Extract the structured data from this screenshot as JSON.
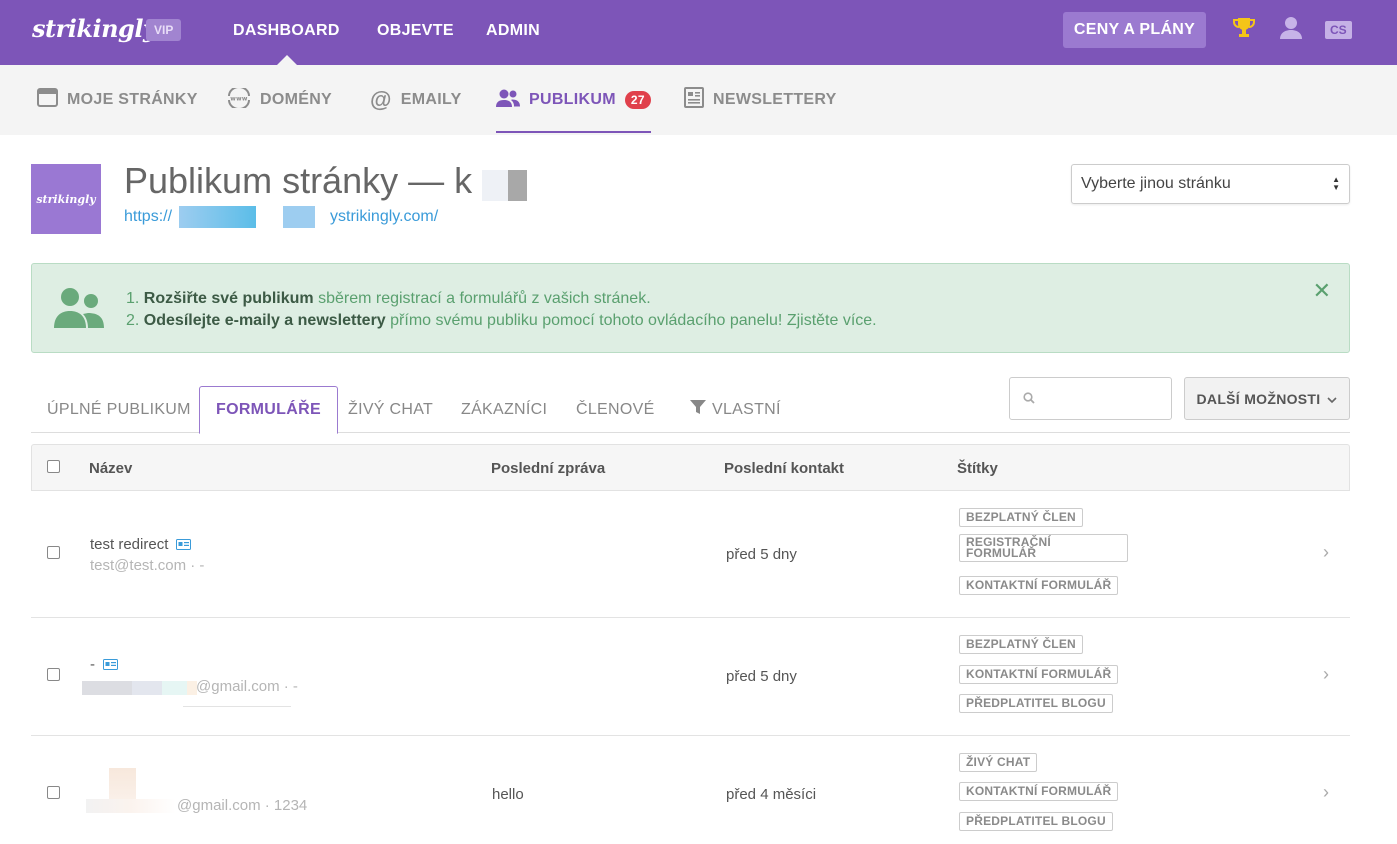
{
  "topbar": {
    "logo": "strikingly",
    "vip_badge": "VIP",
    "nav": [
      "DASHBOARD",
      "OBJEVTE",
      "ADMIN"
    ],
    "plans_button": "CENY A PLÁNY",
    "language": "CS",
    "accent_color": "#7d55b8"
  },
  "subnav": {
    "items": [
      {
        "label": "MOJE STRÁNKY",
        "icon": "browser-window-icon"
      },
      {
        "label": "DOMÉNY",
        "icon": "www-globe-icon"
      },
      {
        "label": "EMAILY",
        "icon": "at-sign-icon"
      },
      {
        "label": "PUBLIKUM",
        "icon": "users-icon",
        "badge": "27",
        "active": true
      },
      {
        "label": "NEWSLETTERY",
        "icon": "newsletter-icon"
      }
    ]
  },
  "page": {
    "thumb_text": "strikingly",
    "title": "Publikum stránky — k",
    "url_prefix": "https://",
    "url_suffix": "ystrikingly.com/",
    "site_select": "Vyberte jinou stránku"
  },
  "info": {
    "line1_num": "1.",
    "line1_bold": "Rozšiřte své publikum",
    "line1_rest": "sběrem registrací a formulářů z vašich stránek.",
    "line2_num": "2.",
    "line2_bold": "Odesílejte e-maily a newslettery",
    "line2_rest": "přímo svému publiku pomocí tohoto ovládacího panelu! Zjistěte více.",
    "close": "✕"
  },
  "tabs": {
    "items": [
      "ÚPLNÉ PUBLIKUM",
      "FORMULÁŘE",
      "ŽIVÝ CHAT",
      "ZÁKAZNÍCI",
      "ČLENOVÉ",
      "VLASTNÍ"
    ],
    "active": "FORMULÁŘE",
    "search_placeholder": "",
    "more_button": "DALŠÍ MOŽNOSTI"
  },
  "table": {
    "headers": [
      "Název",
      "Poslední zpráva",
      "Poslední kontakt",
      "Štítky"
    ],
    "rows": [
      {
        "name": "test redirect",
        "email": "test@test.com · -",
        "message": "",
        "contact": "před 5 dny",
        "tags": [
          "BEZPLATNÝ ČLEN",
          "REGISTRAČNÍ FORMULÁŘ",
          "KONTAKTNÍ FORMULÁŘ"
        ]
      },
      {
        "name": "-",
        "email": "@gmail.com · -",
        "message": "",
        "contact": "před 5 dny",
        "tags": [
          "BEZPLATNÝ ČLEN",
          "KONTAKTNÍ FORMULÁŘ",
          "PŘEDPLATITEL BLOGU"
        ]
      },
      {
        "name": "",
        "email": "@gmail.com · 1234",
        "message": "hello",
        "contact": "před 4 měsíci",
        "tags": [
          "ŽIVÝ CHAT",
          "KONTAKTNÍ FORMULÁŘ",
          "PŘEDPLATITEL BLOGU"
        ]
      }
    ]
  }
}
